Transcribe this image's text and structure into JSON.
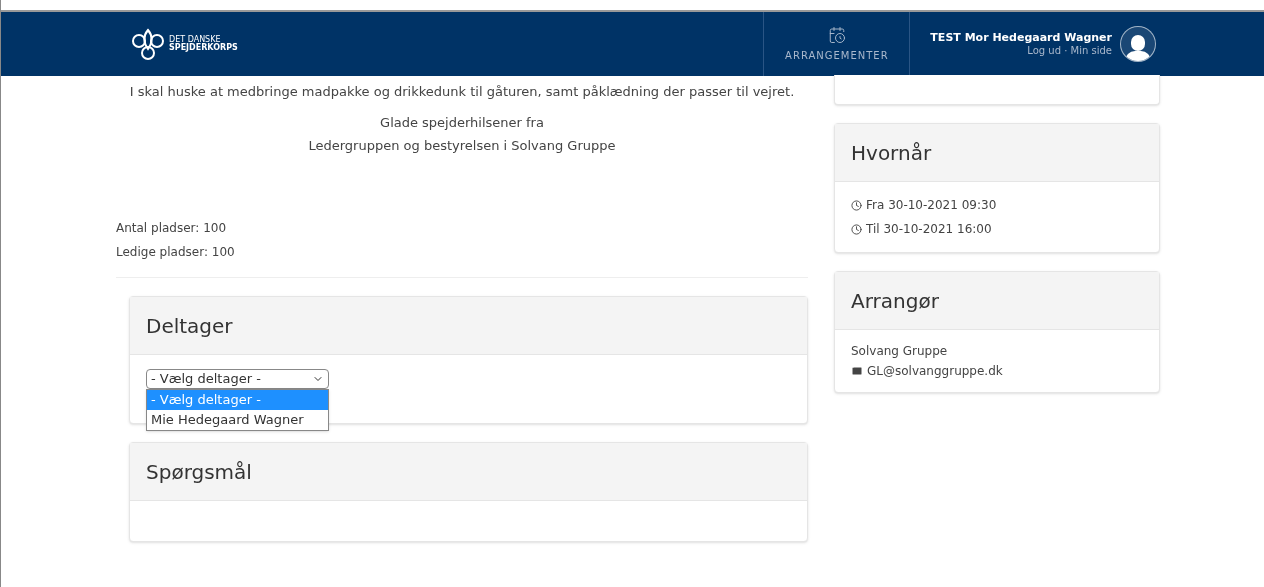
{
  "header": {
    "logo_text": [
      "DET DANSKE",
      "SPEJDERKORPS"
    ],
    "nav": [
      {
        "label": "ARRANGEMENTER"
      }
    ],
    "user": {
      "name": "TEST Mor Hedegaard Wagner",
      "links": "Log ud · Min side"
    }
  },
  "description": {
    "paragraphs": [
      "I skal huske at medbringe madpakke og drikkedunk til gåturen, samt påklædning der passer til vejret.",
      "Glade spejderhilsener fra\nLedergruppen og bestyrelsen i Solvang Gruppe"
    ]
  },
  "seats": [
    "Antal pladser: 100",
    "Ledige pladser: 100"
  ],
  "participant": {
    "title": "Deltager",
    "select_value": "- Vælg deltager -",
    "options": [
      {
        "label": "- Vælg deltager -",
        "selected": true
      },
      {
        "label": "Mie Hedegaard Wagner",
        "selected": false
      }
    ]
  },
  "questions": {
    "title": "Spørgsmål"
  },
  "when": {
    "title": "Hvornår",
    "lines": [
      "Fra 30-10-2021 09:30",
      "Til 30-10-2021 16:00"
    ]
  },
  "organizer": {
    "title": "Arrangør",
    "name": "Solvang Gruppe",
    "email": "GL@solvanggruppe.dk"
  }
}
